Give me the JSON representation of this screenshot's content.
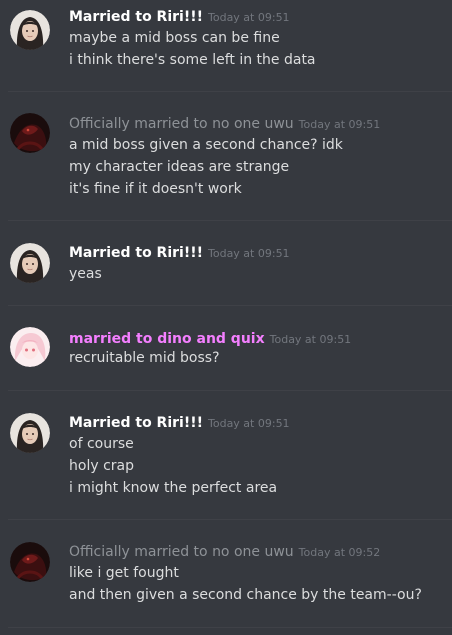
{
  "messages": [
    {
      "author": "Married to Riri!!!",
      "timestamp": "Today at 09:51",
      "avatar_icon": "girl-portrait-avatar",
      "lines": [
        "maybe a mid boss can be fine",
        "i think there's some left in the data"
      ]
    },
    {
      "author": "Officially married to no one uwu",
      "timestamp": "Today at 09:51",
      "avatar_icon": "dark-red-figure-avatar",
      "lines": [
        "a mid boss given a second chance? idk",
        "my character ideas are strange",
        "it's fine if it doesn't work"
      ]
    },
    {
      "author": "Married to Riri!!!",
      "timestamp": "Today at 09:51",
      "avatar_icon": "girl-portrait-avatar",
      "lines": [
        "yeas"
      ]
    },
    {
      "author": "married to dino and quix",
      "timestamp": "Today at 09:51",
      "avatar_icon": "pink-anime-avatar",
      "lines": [
        "recruitable mid boss?"
      ]
    },
    {
      "author": "Married to Riri!!!",
      "timestamp": "Today at 09:51",
      "avatar_icon": "girl-portrait-avatar",
      "lines": [
        "of course",
        "holy crap",
        "i might know the perfect area"
      ]
    },
    {
      "author": "Officially married to no one uwu",
      "timestamp": "Today at 09:52",
      "avatar_icon": "dark-red-figure-avatar",
      "lines": [
        "like i get fought",
        "and then given a second chance by the team--ou?"
      ]
    }
  ],
  "colors": {
    "background": "#36393f",
    "username_default": "#ffffff",
    "username_gray": "#8e9297",
    "username_pink": "#f47fff",
    "timestamp": "#72767d",
    "message_text": "#dcddde"
  }
}
